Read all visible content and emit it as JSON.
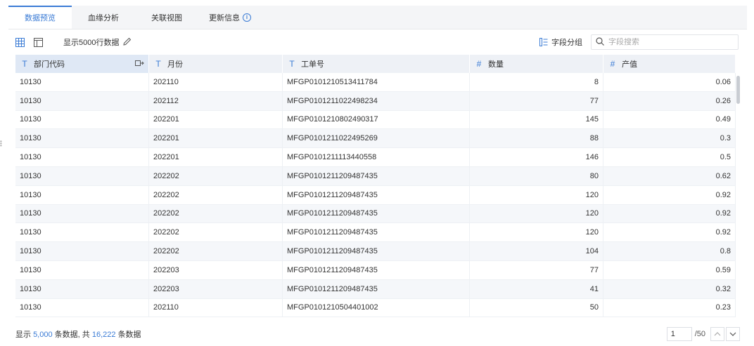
{
  "tabs": [
    {
      "label": "数据预览"
    },
    {
      "label": "血缘分析"
    },
    {
      "label": "关联视图"
    },
    {
      "label": "更新信息"
    }
  ],
  "toolbar": {
    "row_info": "显示5000行数据",
    "group_label": "字段分组",
    "search_placeholder": "字段搜索"
  },
  "columns": [
    {
      "type_icon": "T",
      "name": "部门代码"
    },
    {
      "type_icon": "T",
      "name": "月份"
    },
    {
      "type_icon": "T",
      "name": "工单号"
    },
    {
      "type_icon": "#",
      "name": "数量"
    },
    {
      "type_icon": "#",
      "name": "产值"
    }
  ],
  "rows": [
    [
      "10130",
      "202110",
      "MFGP0101210513411784",
      "8",
      "0.06"
    ],
    [
      "10130",
      "202112",
      "MFGP0101211022498234",
      "77",
      "0.26"
    ],
    [
      "10130",
      "202201",
      "MFGP0101210802490317",
      "145",
      "0.49"
    ],
    [
      "10130",
      "202201",
      "MFGP0101211022495269",
      "88",
      "0.3"
    ],
    [
      "10130",
      "202201",
      "MFGP0101211113440558",
      "146",
      "0.5"
    ],
    [
      "10130",
      "202202",
      "MFGP0101211209487435",
      "80",
      "0.62"
    ],
    [
      "10130",
      "202202",
      "MFGP0101211209487435",
      "120",
      "0.92"
    ],
    [
      "10130",
      "202202",
      "MFGP0101211209487435",
      "120",
      "0.92"
    ],
    [
      "10130",
      "202202",
      "MFGP0101211209487435",
      "120",
      "0.92"
    ],
    [
      "10130",
      "202202",
      "MFGP0101211209487435",
      "104",
      "0.8"
    ],
    [
      "10130",
      "202203",
      "MFGP0101211209487435",
      "77",
      "0.59"
    ],
    [
      "10130",
      "202203",
      "MFGP0101211209487435",
      "41",
      "0.32"
    ],
    [
      "10130",
      "202110",
      "MFGP0101210504401002",
      "50",
      "0.23"
    ]
  ],
  "footer": {
    "prefix": "显示",
    "shown": "5,000",
    "middle": "条数据, 共",
    "total": "16,222",
    "suffix": "条数据",
    "page": "1",
    "pages": "/50"
  },
  "colors": {
    "accent": "#3a7bd5",
    "header_bg": "#eef1f6",
    "tabbar_bg": "#f4f5f7"
  }
}
